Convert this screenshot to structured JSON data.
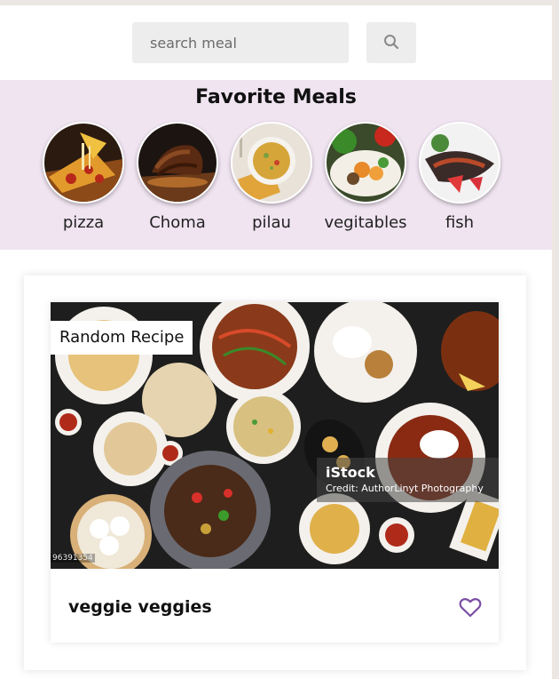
{
  "search": {
    "placeholder": "search meal",
    "button_icon": "search-icon"
  },
  "favorites": {
    "title": "Favorite Meals",
    "items": [
      {
        "label": "pizza"
      },
      {
        "label": "Choma"
      },
      {
        "label": "pilau"
      },
      {
        "label": "vegitables"
      },
      {
        "label": "fish"
      }
    ]
  },
  "random": {
    "tag": "Random Recipe",
    "meal_name": "veggie veggies",
    "favorite_icon": "heart-outline-icon",
    "watermark": {
      "brand": "iStock",
      "credit": "Credit: AuthorLinyt Photography",
      "id": "96391354"
    }
  },
  "colors": {
    "favorites_bg": "#f0e4f1",
    "heart": "#7a4fa3",
    "input_bg": "#ededed",
    "page_bg": "#ece7e2"
  }
}
